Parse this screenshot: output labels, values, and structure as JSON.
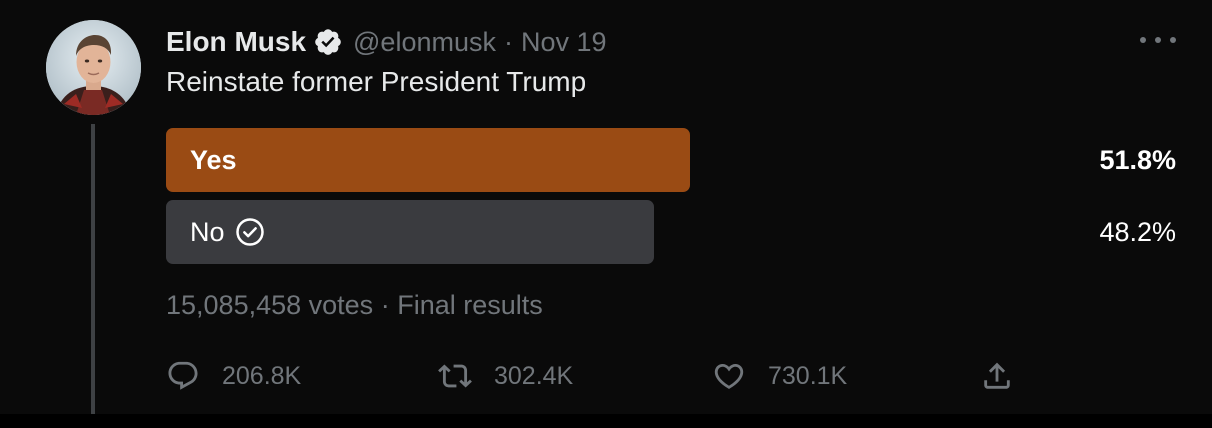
{
  "author": {
    "name": "Elon Musk",
    "handle": "@elonmusk",
    "separator": "·",
    "date": "Nov 19",
    "verified": true
  },
  "tweet": {
    "text": "Reinstate former President Trump"
  },
  "poll": {
    "options": [
      {
        "label": "Yes",
        "percent_text": "51.8%",
        "percent": 51.8,
        "leading": true,
        "selected": false,
        "bar_color": "#9a4b14"
      },
      {
        "label": "No",
        "percent_text": "48.2%",
        "percent": 48.2,
        "leading": false,
        "selected": true,
        "bar_color": "#3a3b3f"
      }
    ],
    "votes": "15,085,458 votes",
    "separator": "·",
    "status": "Final results"
  },
  "actions": {
    "reply": {
      "icon": "reply-icon",
      "count": "206.8K"
    },
    "retweet": {
      "icon": "retweet-icon",
      "count": "302.4K"
    },
    "like": {
      "icon": "heart-icon",
      "count": "730.1K"
    },
    "share": {
      "icon": "share-icon"
    }
  },
  "colors": {
    "background": "#0a0a0a",
    "text_primary": "#e7e9ea",
    "text_secondary": "#71767b",
    "poll_winner": "#9a4b14",
    "poll_other": "#3a3b3f"
  }
}
